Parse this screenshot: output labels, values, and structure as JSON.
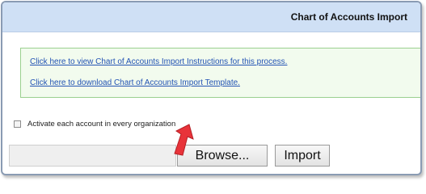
{
  "header": {
    "title": "Chart of Accounts Import"
  },
  "links": {
    "instructions": "Click here to view Chart of Accounts Import Instructions for this process.",
    "template": "Click here to download Chart of Accounts Import Template."
  },
  "activate": {
    "label": "Activate each account in every organization",
    "checked": false
  },
  "file_input": {
    "value": ""
  },
  "buttons": {
    "browse": "Browse...",
    "import": "Import"
  },
  "annotation": {
    "icon": "pointer-arrow-icon",
    "color": "#e8333a"
  },
  "colors": {
    "header_bg": "#cfe0f5",
    "link": "#2453b4",
    "links_box_border": "#9ad08f"
  }
}
